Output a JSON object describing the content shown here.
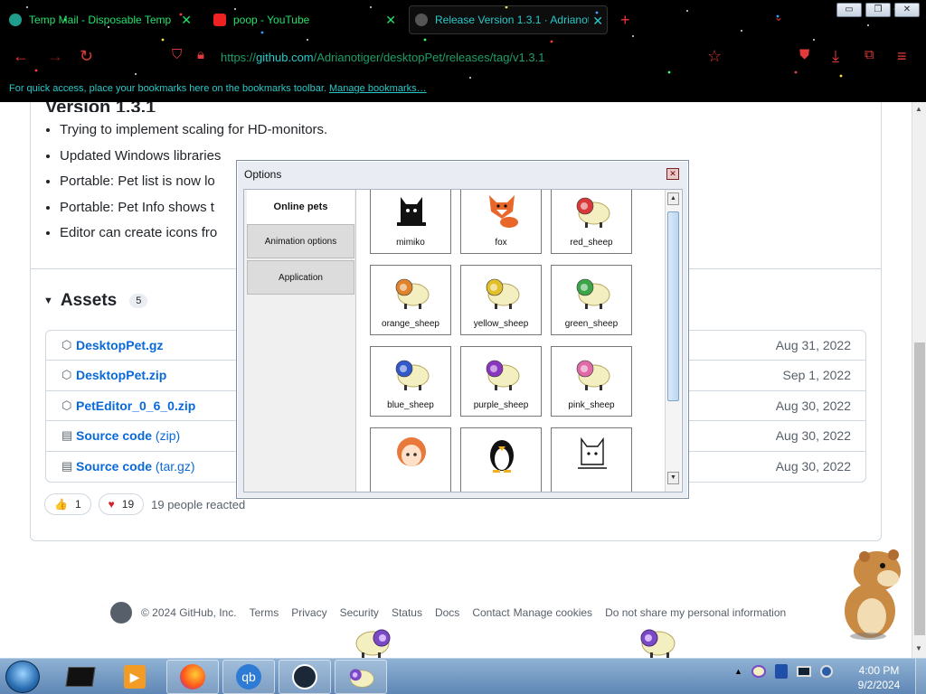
{
  "browser": {
    "tabs": [
      {
        "title": "Temp Mail - Disposable Temp",
        "close": "✕"
      },
      {
        "title": "poop - YouTube",
        "close": "✕"
      },
      {
        "title": "Release Version 1.3.1 · Adrianot",
        "close": "✕"
      }
    ],
    "new_tab": "+",
    "tab_list": "⌄",
    "url_prefix": "https://",
    "url_domain": "github.com",
    "url_path": "/Adrianotiger/desktopPet/releases/tag/v1.3.1",
    "bookmarks_msg": "For quick access, place your bookmarks here on the bookmarks toolbar.",
    "bookmarks_link": "Manage bookmarks…",
    "window_buttons": [
      "▭",
      "❐",
      "✕"
    ]
  },
  "release": {
    "title": "Version 1.3.1",
    "notes": [
      "Trying to implement scaling for HD-monitors.",
      "Updated Windows libraries",
      "Portable: Pet list is now lo",
      "Portable: Pet Info shows t",
      "Editor can create icons fro"
    ],
    "assets_label": "Assets",
    "assets_count": "5",
    "assets": [
      {
        "name": "DesktopPet.gz",
        "date": "Aug 31, 2022"
      },
      {
        "name": "DesktopPet.zip",
        "date": "Sep 1, 2022"
      },
      {
        "name": "PetEditor_0_6_0.zip",
        "date": "Aug 30, 2022"
      },
      {
        "name": "Source code",
        "suffix": " (zip)",
        "date": "Aug 30, 2022"
      },
      {
        "name": "Source code",
        "suffix": " (tar.gz)",
        "date": "Aug 30, 2022"
      }
    ],
    "reactions": {
      "thumbs_emoji": "👍",
      "thumbs_count": "1",
      "heart_emoji": "♥",
      "heart_count": "19",
      "summary": "19 people reacted"
    }
  },
  "footer": {
    "copyright": "© 2024 GitHub, Inc.",
    "links": [
      "Terms",
      "Privacy",
      "Security",
      "Status",
      "Docs",
      "Contact",
      "Manage cookies",
      "Do not share my personal information"
    ]
  },
  "dialog": {
    "title": "Options",
    "close": "✕",
    "tabs": [
      "Online pets",
      "Animation options",
      "Application"
    ],
    "pets": [
      "mimiko",
      "fox",
      "red_sheep",
      "orange_sheep",
      "yellow_sheep",
      "green_sheep",
      "blue_sheep",
      "purple_sheep",
      "pink_sheep",
      "",
      "",
      ""
    ],
    "colors": {
      "red_sheep": "#d83a3a",
      "orange_sheep": "#e0832a",
      "yellow_sheep": "#e2c02a",
      "green_sheep": "#3aa648",
      "blue_sheep": "#3159c9",
      "purple_sheep": "#8a37c0",
      "pink_sheep": "#e06aa8"
    }
  },
  "taskbar": {
    "clock_time": "4:00 PM",
    "clock_date": "9/2/2024",
    "apps": [
      "terminal-icon",
      "media-player-icon",
      "firefox-icon",
      "qbittorrent-icon",
      "steam-icon",
      "sheep-pet-icon"
    ],
    "qb_label": "qb",
    "tray_arrow": "▲"
  }
}
